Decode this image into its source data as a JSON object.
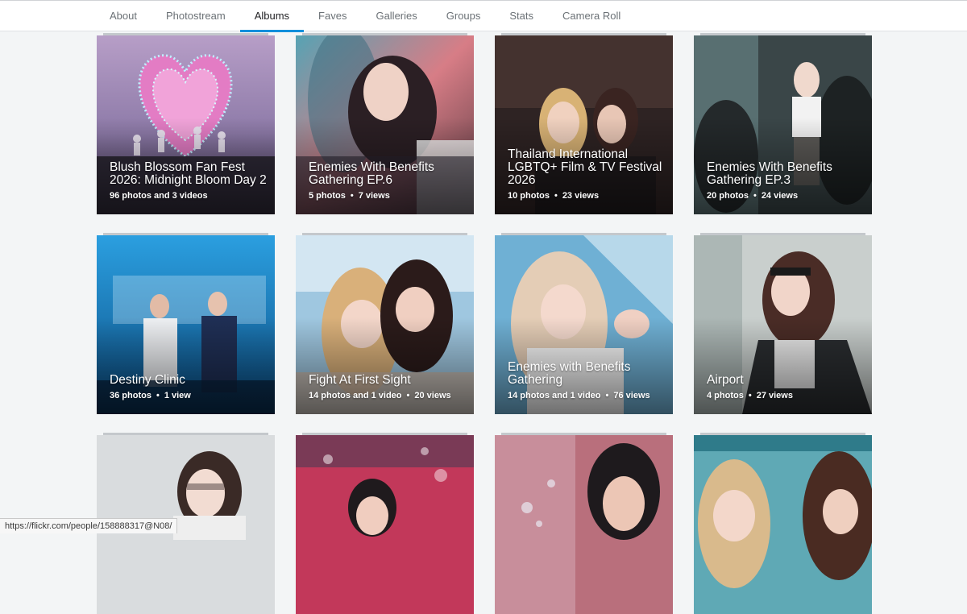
{
  "nav": {
    "tabs": [
      {
        "label": "About"
      },
      {
        "label": "Photostream"
      },
      {
        "label": "Albums",
        "active": true
      },
      {
        "label": "Faves"
      },
      {
        "label": "Galleries"
      },
      {
        "label": "Groups"
      },
      {
        "label": "Stats"
      },
      {
        "label": "Camera Roll"
      }
    ]
  },
  "albums": [
    {
      "title": "Blush Blossom Fan Fest 2026: Midnight Bloom Day 2",
      "photos": "96 photos and 3 videos",
      "views": ""
    },
    {
      "title": "Enemies With Benefits Gathering EP.6",
      "photos": "5 photos",
      "views": "7 views"
    },
    {
      "title": "Thailand International LGBTQ+ Film & TV Festival 2026",
      "photos": "10 photos",
      "views": "23 views"
    },
    {
      "title": "Enemies With Benefits Gathering EP.3",
      "photos": "20 photos",
      "views": "24 views"
    },
    {
      "title": "Destiny Clinic",
      "photos": "36 photos",
      "views": "1 view"
    },
    {
      "title": "Fight At First Sight",
      "photos": "14 photos and 1 video",
      "views": "20 views"
    },
    {
      "title": "Enemies with Benefits Gathering",
      "photos": "14 photos and 1 video",
      "views": "76 views"
    },
    {
      "title": "Airport",
      "photos": "4 photos",
      "views": "27 views"
    },
    {
      "title": "",
      "photos": "",
      "views": ""
    },
    {
      "title": "",
      "photos": "",
      "views": ""
    },
    {
      "title": "",
      "photos": "",
      "views": ""
    },
    {
      "title": "",
      "photos": "",
      "views": ""
    }
  ],
  "status_bar": {
    "url": "https://flickr.com/people/158888317@N08/"
  },
  "colors": {
    "accent": "#128fdc",
    "background": "#f3f5f6"
  }
}
